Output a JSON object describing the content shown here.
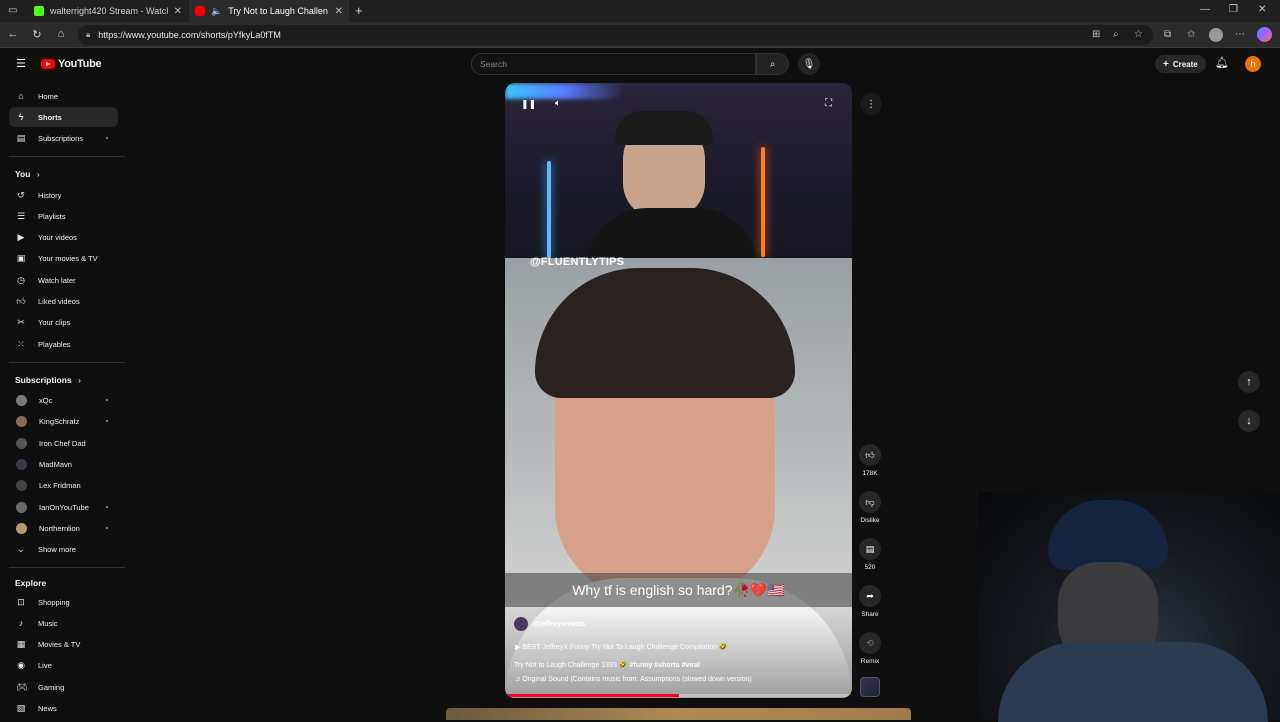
{
  "browser": {
    "tabs": [
      {
        "title": "walterright420 Stream - Watch Li",
        "favicon_color": "#53fc18"
      },
      {
        "title": "Try Not to Laugh Challenge",
        "favicon_color": "#ff0000"
      }
    ],
    "url": "https://www.youtube.com/shorts/pYfkyLa0fTM"
  },
  "header": {
    "logo_text": "YouTube",
    "search_placeholder": "Search",
    "create_label": "Create",
    "avatar_letter": "h"
  },
  "sidebar": {
    "main": [
      {
        "label": "Home",
        "icon": "home-icon"
      },
      {
        "label": "Shorts",
        "icon": "shorts-icon",
        "active": true
      },
      {
        "label": "Subscriptions",
        "icon": "subscriptions-icon",
        "dot": true
      }
    ],
    "you_heading": "You",
    "you": [
      {
        "label": "History"
      },
      {
        "label": "Playlists"
      },
      {
        "label": "Your videos"
      },
      {
        "label": "Your movies & TV"
      },
      {
        "label": "Watch later"
      },
      {
        "label": "Liked videos"
      },
      {
        "label": "Your clips"
      },
      {
        "label": "Playables"
      }
    ],
    "subs_heading": "Subscriptions",
    "subs": [
      {
        "label": "xQc",
        "dot": true,
        "color": "#7a7a7a"
      },
      {
        "label": "KingSchratz",
        "dot": true,
        "color": "#8a6a55"
      },
      {
        "label": "Iron Chef Dad",
        "dot": false,
        "color": "#555"
      },
      {
        "label": "MadMavn",
        "dot": false,
        "color": "#3a3a4a"
      },
      {
        "label": "Lex Fridman",
        "dot": false,
        "color": "#444"
      },
      {
        "label": "IanOnYouTube",
        "dot": true,
        "color": "#6a6a6a"
      },
      {
        "label": "Northernlion",
        "dot": true,
        "color": "#b89a70"
      }
    ],
    "show_more": "Show more",
    "explore_heading": "Explore",
    "explore": [
      {
        "label": "Shopping"
      },
      {
        "label": "Music"
      },
      {
        "label": "Movies & TV"
      },
      {
        "label": "Live"
      },
      {
        "label": "Gaming"
      },
      {
        "label": "News"
      }
    ]
  },
  "video": {
    "watermark": "@FLUENTLYTIPS",
    "caption": "Why tf is english so hard?🥀💔🇺🇸",
    "channel": "@jeffreyxreacts",
    "playlist": "BEST JeffreyX Funny Try Not To Laugh Challenge Compilation 🤣",
    "title": "Try Not to Laugh Challenge 1393 🤣",
    "title_tags": "#funny #shorts #viral",
    "sound": "Original Sound (Contains music from: Assumptions (slowed down version)",
    "progress": 0.5
  },
  "actions": {
    "likes": "178K",
    "dislike": "Dislike",
    "comments": "520",
    "share": "Share",
    "remix": "Remix"
  }
}
